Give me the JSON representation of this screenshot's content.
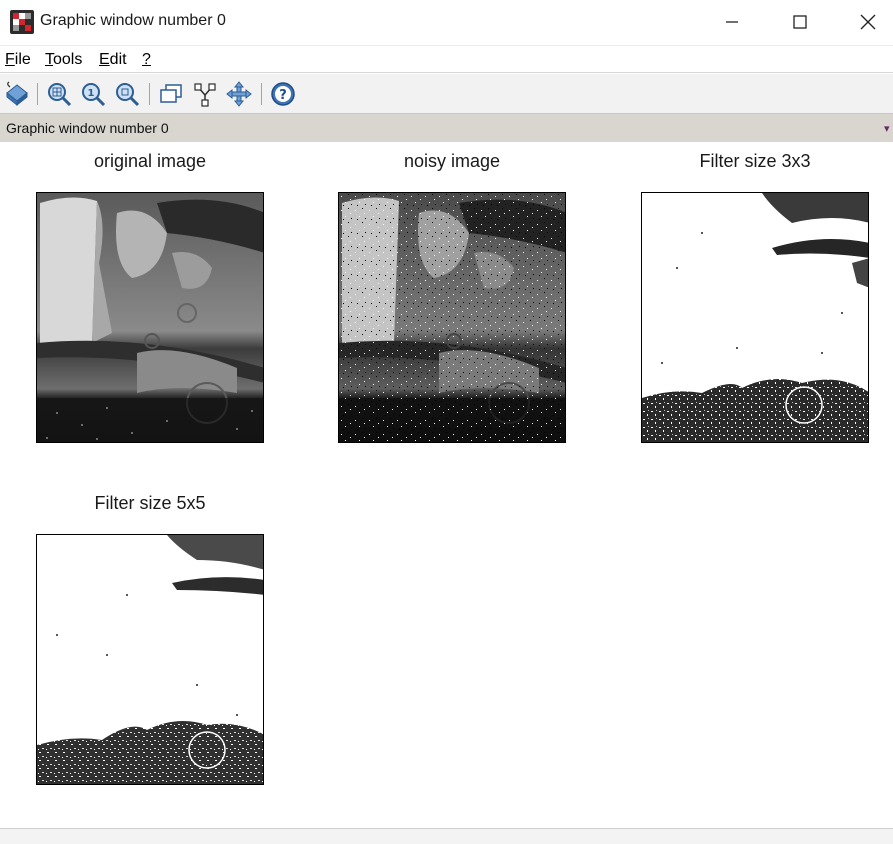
{
  "window": {
    "title": "Graphic window number 0",
    "icon": "scilab-app-icon"
  },
  "menu": {
    "items": [
      {
        "label": "File",
        "underline": "F",
        "rest": "ile"
      },
      {
        "label": "Tools",
        "underline": "T",
        "rest": "ools"
      },
      {
        "label": "Edit",
        "underline": "E",
        "rest": "dit"
      },
      {
        "label": "?",
        "underline": "?",
        "rest": ""
      }
    ]
  },
  "toolbar": {
    "buttons": [
      "2d-3d-rotate-icon",
      "zoom-in-icon",
      "zoom-original-icon",
      "zoom-out-icon",
      "new-window-icon",
      "datatip-icon",
      "pan-icon",
      "help-icon"
    ]
  },
  "status": {
    "label": "Graphic window number 0"
  },
  "plots": [
    {
      "title": "original image"
    },
    {
      "title": "noisy image"
    },
    {
      "title": "Filter size 3x3"
    },
    {
      "title": "Filter size 5x5"
    }
  ]
}
